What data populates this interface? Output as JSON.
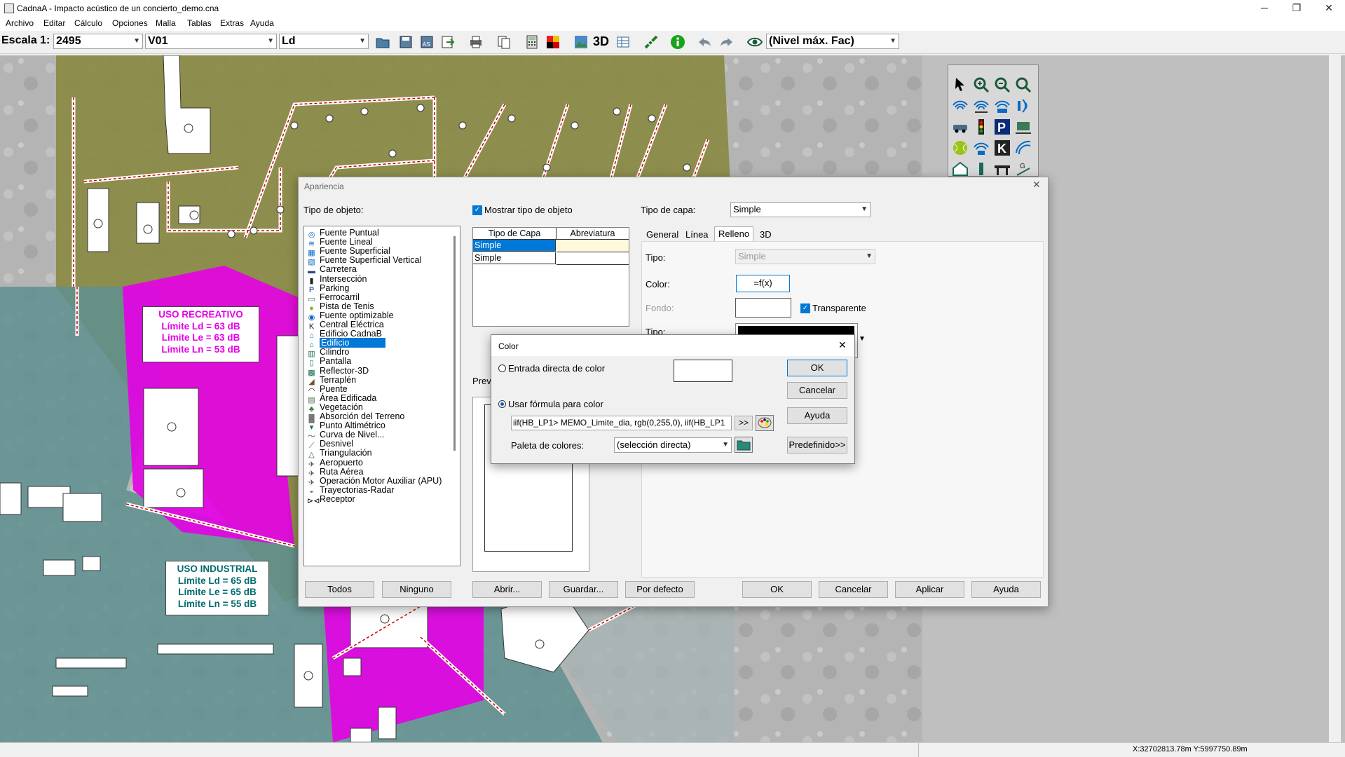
{
  "window": {
    "title": "CadnaA - Impacto acústico de un concierto_demo.cna",
    "minimize": "─",
    "maximize": "❐",
    "close": "✕"
  },
  "menu": [
    "Archivo",
    "Editar",
    "Cálculo",
    "Opciones",
    "Malla",
    "Tablas",
    "Extras",
    "Ayuda"
  ],
  "toolbar": {
    "scale_label": "Escala 1:",
    "scale_value": "2495",
    "variant": "V01",
    "level": "Ld",
    "view_3d": "3D",
    "grid_mode": "(Nivel máx. Fac)"
  },
  "map": {
    "recreativo": {
      "title": "USO RECREATIVO",
      "ld": "Límite Ld = 63 dB",
      "le": "Límite Le = 63 dB",
      "ln": "Límite Ln = 53 dB",
      "color": "#e600e6"
    },
    "industrial": {
      "title": "USO INDUSTRIAL",
      "ld": "Límite Ld = 65 dB",
      "le": "Límite Le = 65 dB",
      "ln": "Límite Ln = 55 dB",
      "color": "#006b6b"
    }
  },
  "status": {
    "coords": "X:32702813.78m Y:5997750.89m"
  },
  "apariencia": {
    "title": "Apariencia",
    "tipo_objeto_label": "Tipo de objeto:",
    "mostrar_tipo": "Mostrar tipo de objeto",
    "object_types": [
      "Fuente Puntual",
      "Fuente Lineal",
      "Fuente Superficial",
      "Fuente Superficial Vertical",
      "Carretera",
      "Intersección",
      "Parking",
      "Ferrocarril",
      "Pista de Tenis",
      "Fuente optimizable",
      "Central Eléctrica",
      "Edificio CadnaB",
      "Edificio",
      "Cilindro",
      "Pantalla",
      "Reflector-3D",
      "Terraplén",
      "Puente",
      "Área Edificada",
      "Vegetación",
      "Absorción del Terreno",
      "Punto Altimétrico",
      "Curva de Nivel...",
      "Desnivel",
      "Triangulación",
      "Aeropuerto",
      "Ruta Aérea",
      "Operación Motor Auxiliar (APU)",
      "Trayectorias-Radar",
      "Receptor"
    ],
    "selected_type": "Edificio",
    "layer_table": {
      "headers": [
        "Tipo de Capa",
        "Abreviatura"
      ],
      "rows": [
        [
          "Simple",
          ""
        ],
        [
          "Simple",
          ""
        ]
      ]
    },
    "preview_label": "Prev",
    "tipo_capa_label": "Tipo de capa:",
    "tipo_capa_value": "Simple",
    "tabs": [
      "General",
      "Línea",
      "Relleno",
      "3D"
    ],
    "active_tab": "Relleno",
    "tipo_label": "Tipo:",
    "tipo_value": "Simple",
    "color_label": "Color:",
    "color_value": "=f(x)",
    "fondo_label": "Fondo:",
    "transparente": "Transparente",
    "tipo2_label": "Tipo:",
    "buttons": {
      "todos": "Todos",
      "ninguno": "Ninguno",
      "abrir": "Abrir...",
      "guardar": "Guardar...",
      "por_defecto": "Por defecto",
      "ok": "OK",
      "cancelar": "Cancelar",
      "aplicar": "Aplicar",
      "ayuda": "Ayuda"
    }
  },
  "color_dialog": {
    "title": "Color",
    "close": "✕",
    "direct_label": "Entrada directa de color",
    "formula_label": "Usar fórmula para color",
    "formula_value": "iif(HB_LP1> MEMO_Limite_dia, rgb(0,255,0), iif(HB_LP1",
    "expand": ">>",
    "palette_label": "Paleta de colores:",
    "palette_value": "(selección directa)",
    "ok": "OK",
    "cancelar": "Cancelar",
    "ayuda": "Ayuda",
    "predefinido": "Predefinido>>"
  }
}
